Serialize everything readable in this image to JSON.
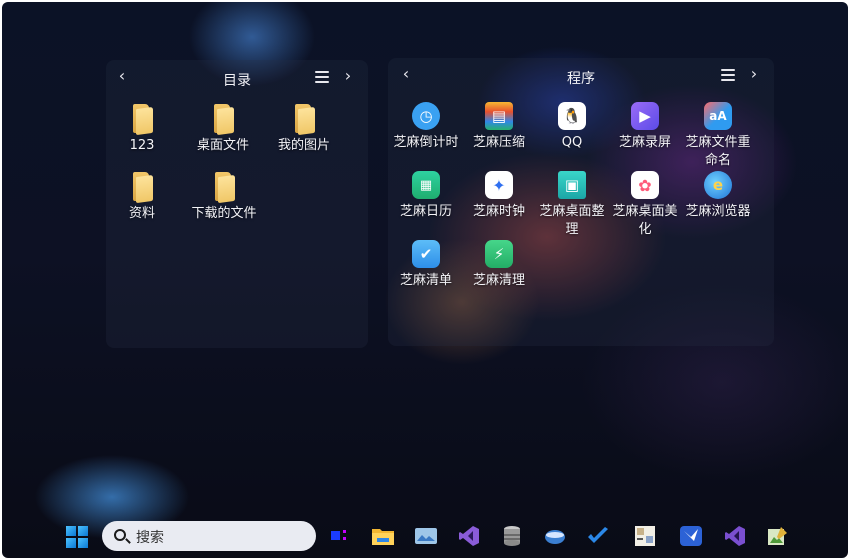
{
  "left_panel": {
    "title": "目录",
    "prev": "‹",
    "next": "›",
    "items": [
      {
        "label": "123"
      },
      {
        "label": "桌面文件"
      },
      {
        "label": "我的图片"
      },
      {
        "label": "资料"
      },
      {
        "label": "下载的文件"
      }
    ]
  },
  "right_panel": {
    "title": "程序",
    "prev": "‹",
    "next": "›",
    "apps": [
      {
        "label": "芝麻倒计时",
        "icon": "countdown-icon",
        "color": "#3aa1f2"
      },
      {
        "label": "芝麻压缩",
        "icon": "archive-icon",
        "color": "#e8502e"
      },
      {
        "label": "QQ",
        "icon": "qq-icon",
        "color": "#ffffff"
      },
      {
        "label": "芝麻录屏",
        "icon": "screen-record-icon",
        "color": "#7b5cf0"
      },
      {
        "label": "芝麻文件重命名",
        "icon": "rename-icon",
        "color": "#2f9bf0"
      },
      {
        "label": "芝麻日历",
        "icon": "calendar-icon",
        "color": "#27c28a"
      },
      {
        "label": "芝麻时钟",
        "icon": "clock-icon",
        "color": "#ffffff"
      },
      {
        "label": "芝麻桌面整理",
        "icon": "desktop-organize-icon",
        "color": "#20b8b0"
      },
      {
        "label": "芝麻桌面美化",
        "icon": "palette-icon",
        "color": "#ffffff"
      },
      {
        "label": "芝麻浏览器",
        "icon": "browser-icon",
        "color": "#2a8ee8"
      },
      {
        "label": "芝麻清单",
        "icon": "checklist-icon",
        "color": "#3ba7f5"
      },
      {
        "label": "芝麻清理",
        "icon": "cleaner-icon",
        "color": "#2fc27a"
      }
    ]
  },
  "taskbar": {
    "search_placeholder": "搜索",
    "icons": [
      "start-icon",
      "task-view-icon",
      "file-explorer-icon",
      "photos-icon",
      "visual-studio-icon",
      "database-icon",
      "browser-icon",
      "todo-icon",
      "image-editor-icon",
      "feishu-icon",
      "visual-studio-2-icon",
      "paint-icon"
    ]
  }
}
